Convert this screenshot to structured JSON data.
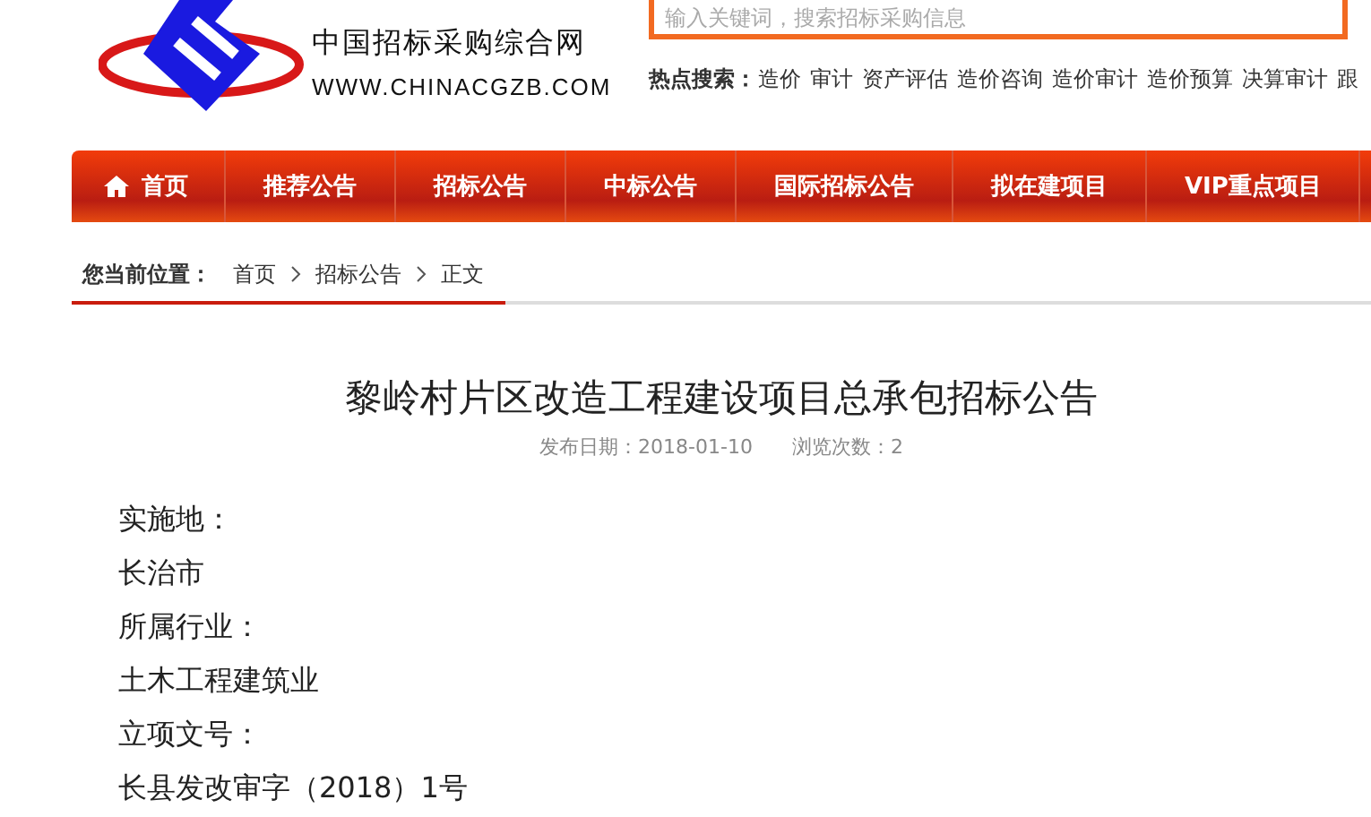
{
  "logo": {
    "name": "中国招标采购综合网",
    "url": "WWW.CHINACGZB.COM"
  },
  "search": {
    "placeholder": "输入关键词，搜索招标采购信息"
  },
  "hot_search": {
    "label": "热点搜索：",
    "items": [
      "造价",
      "审计",
      "资产评估",
      "造价咨询",
      "造价审计",
      "造价预算",
      "决算审计",
      "跟"
    ]
  },
  "nav": [
    {
      "label": "首页",
      "kind": "home"
    },
    {
      "label": "推荐公告",
      "kind": "link"
    },
    {
      "label": "招标公告",
      "kind": "link"
    },
    {
      "label": "中标公告",
      "kind": "link"
    },
    {
      "label": "国际招标公告",
      "kind": "link"
    },
    {
      "label": "拟在建项目",
      "kind": "link"
    },
    {
      "label": "VIP重点项目",
      "kind": "link"
    }
  ],
  "breadcrumb": {
    "label": "您当前位置：",
    "items": [
      "首页",
      "招标公告",
      "正文"
    ]
  },
  "article": {
    "title": "黎岭村片区改造工程建设项目总承包招标公告",
    "date": "发布日期：2018-01-10",
    "views": "浏览次数：2",
    "lines": [
      "实施地：",
      "长治市",
      "所属行业：",
      "土木工程建筑业",
      "立项文号：",
      "长县发改审字（2018）1号"
    ]
  }
}
